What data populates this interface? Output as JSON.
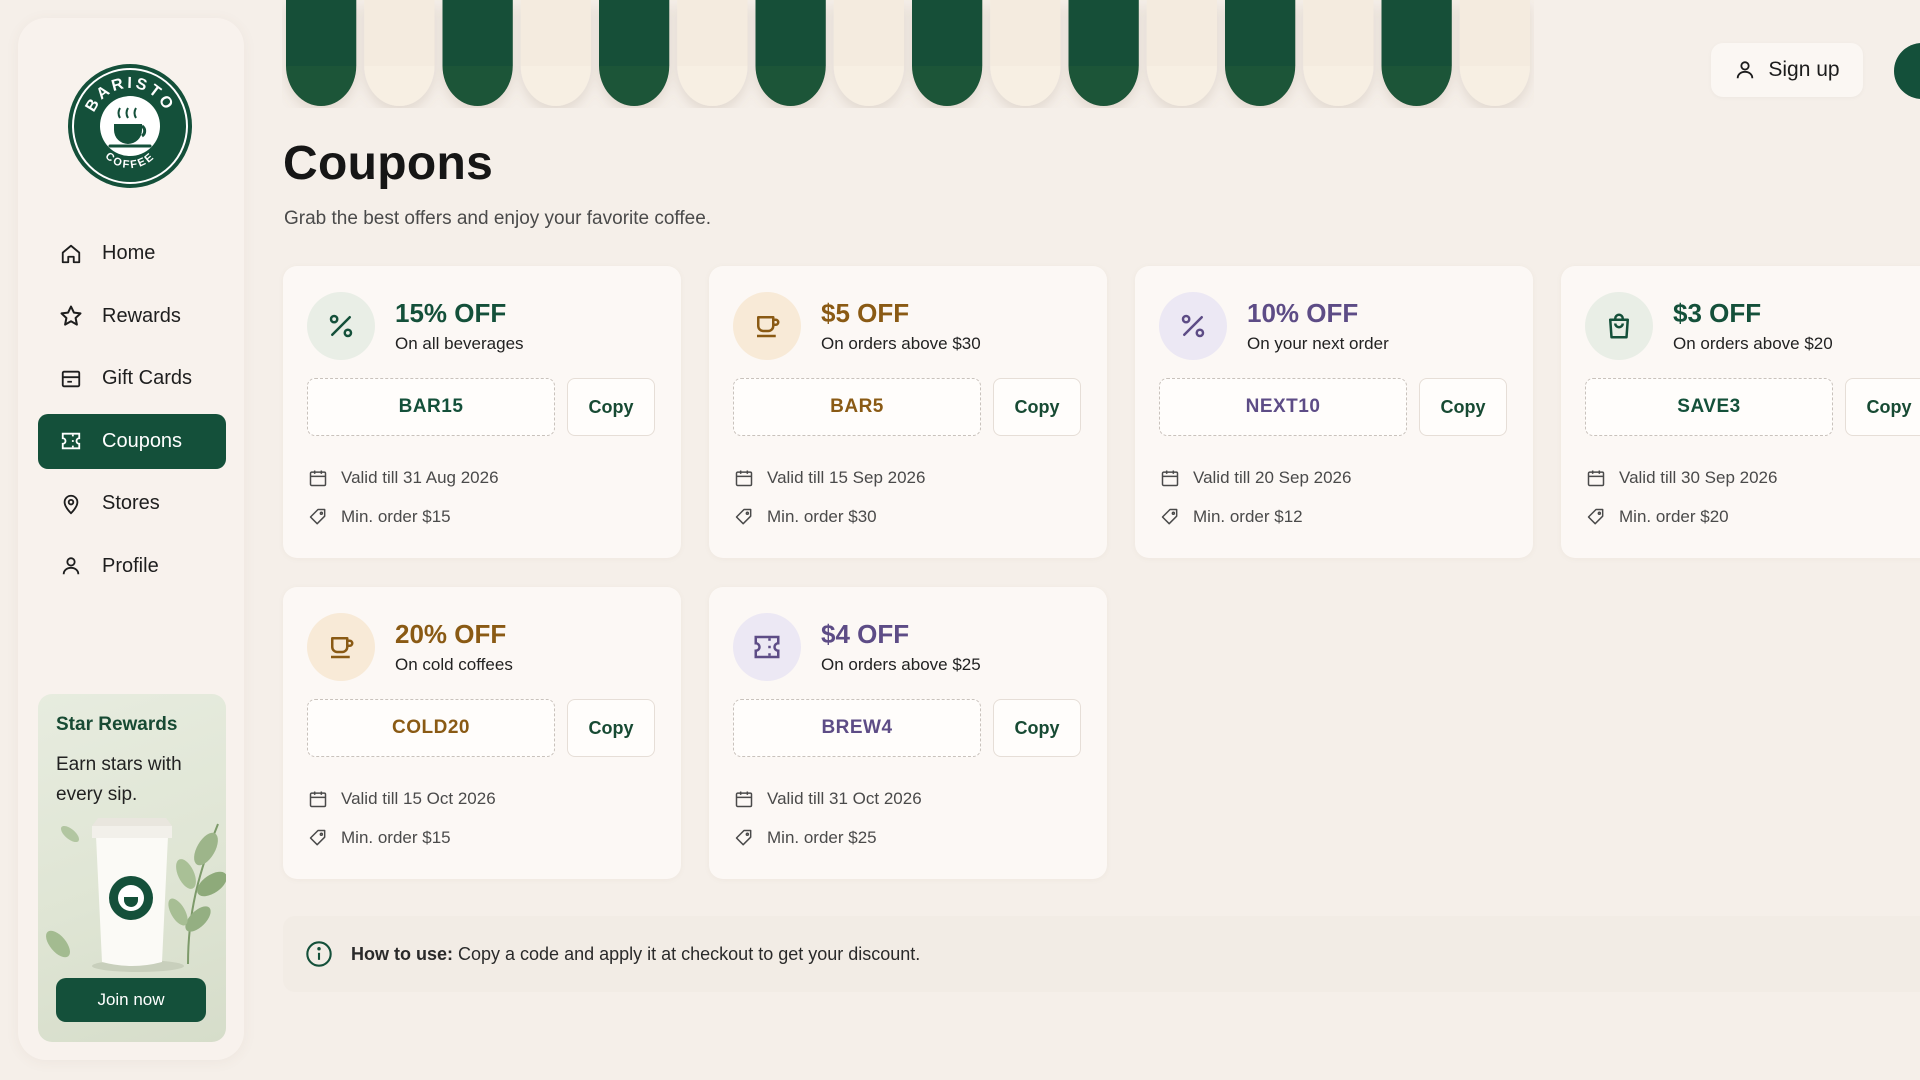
{
  "brand": {
    "logo_text_top": "BARISTO",
    "logo_text_bottom": "COFFEE",
    "color_primary": "#14503a"
  },
  "sidebar": {
    "items": [
      {
        "label": "Home",
        "icon": "home-icon"
      },
      {
        "label": "Rewards",
        "icon": "star-icon"
      },
      {
        "label": "Gift Cards",
        "icon": "gift-card-icon"
      },
      {
        "label": "Coupons",
        "icon": "ticket-icon",
        "active": true
      },
      {
        "label": "Stores",
        "icon": "map-pin-icon"
      },
      {
        "label": "Profile",
        "icon": "user-icon"
      }
    ],
    "promo": {
      "title": "Star Rewards",
      "text": "Earn stars with every sip.",
      "button": "Join now"
    }
  },
  "header": {
    "signup_label": "Sign up",
    "title": "Coupons",
    "subtitle": "Grab the best offers and enjoy your favorite coffee."
  },
  "coupons": [
    {
      "title": "15% OFF",
      "desc": "On all beverages",
      "code": "BAR15",
      "copy": "Copy",
      "valid": "Valid till 31 Aug 2026",
      "min": "Min. order $15",
      "icon": "percent-icon",
      "theme": "green"
    },
    {
      "title": "$5 OFF",
      "desc": "On orders above $30",
      "code": "BAR5",
      "copy": "Copy",
      "valid": "Valid till 15 Sep 2026",
      "min": "Min. order $30",
      "icon": "cup-icon",
      "theme": "amber"
    },
    {
      "title": "10% OFF",
      "desc": "On your next order",
      "code": "NEXT10",
      "copy": "Copy",
      "valid": "Valid till 20 Sep 2026",
      "min": "Min. order $12",
      "icon": "percent-icon",
      "theme": "purple"
    },
    {
      "title": "$3 OFF",
      "desc": "On orders above $20",
      "code": "SAVE3",
      "copy": "Copy",
      "valid": "Valid till 30 Sep 2026",
      "min": "Min. order $20",
      "icon": "shopping-bag-icon",
      "theme": "green"
    },
    {
      "title": "20% OFF",
      "desc": "On cold coffees",
      "code": "COLD20",
      "copy": "Copy",
      "valid": "Valid till 15 Oct 2026",
      "min": "Min. order $15",
      "icon": "cup-icon",
      "theme": "amber"
    },
    {
      "title": "$4 OFF",
      "desc": "On orders above $25",
      "code": "BREW4",
      "copy": "Copy",
      "valid": "Valid till 31 Oct 2026",
      "min": "Min. order $25",
      "icon": "ticket-icon",
      "theme": "purple"
    }
  ],
  "howto": {
    "label": "How to use:",
    "text": "Copy a code and apply it at checkout to get your discount."
  }
}
